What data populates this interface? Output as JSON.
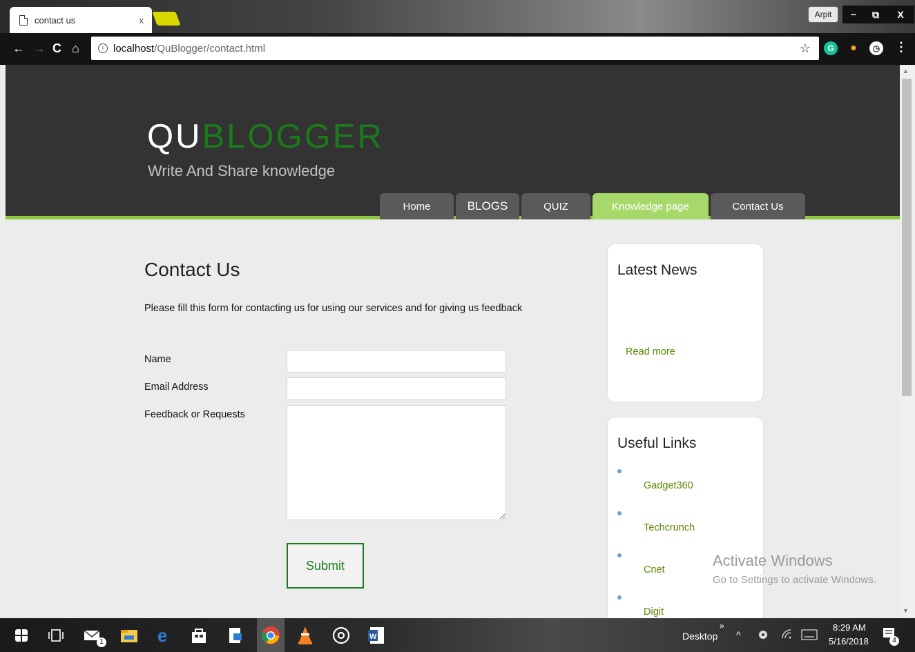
{
  "browser": {
    "tab_title": "contact us",
    "tab_close": "x",
    "profile_name": "Arpit",
    "win_controls": [
      "−",
      "⧉",
      "X"
    ],
    "nav": {
      "back": "←",
      "forward": "→",
      "reload": "C",
      "home": "⌂"
    },
    "url_host": "localhost",
    "url_path": "/QuBlogger/contact.html",
    "info_icon": "i",
    "star": "☆",
    "extensions": [
      {
        "label": "G",
        "color": "#15c39a",
        "icon": "grammarly-icon"
      },
      {
        "label": "●",
        "color": "#f5a623",
        "icon": "bulb-icon"
      },
      {
        "label": "◷",
        "color": "#333333",
        "icon": "gauge-icon"
      }
    ],
    "menu_dots": "⋮"
  },
  "site": {
    "logo_qu": "QU",
    "logo_rest": "BLOGGER",
    "tagline": "Write And Share knowledge",
    "menu": [
      {
        "label": "Home",
        "active": false
      },
      {
        "label": "BLOGS",
        "active": false
      },
      {
        "label": "QUIZ",
        "active": false
      },
      {
        "label": "Knowledge page",
        "active": true
      },
      {
        "label": "Contact Us",
        "active": false
      }
    ]
  },
  "contact": {
    "heading": "Contact Us",
    "intro": "Please fill this form for contacting us for using our services and for giving us feedback",
    "name_label": "Name",
    "email_label": "Email Address",
    "feedback_label": "Feedback or Requests",
    "name_value": "",
    "email_value": "",
    "feedback_value": "",
    "submit_label": "Submit"
  },
  "sidebar": {
    "news_title": "Latest News",
    "read_more": "Read more",
    "links_title": "Useful Links",
    "links": [
      "Gadget360",
      "Techcrunch",
      "Cnet",
      "Digit"
    ]
  },
  "watermark": {
    "title": "Activate Windows",
    "subtitle": "Go to Settings to activate Windows."
  },
  "taskbar": {
    "desktop_label": "Desktop",
    "chevron": "»",
    "time": "8:29 AM",
    "date": "5/16/2018",
    "mail_badge": "1",
    "notification_count": "4"
  },
  "colors": {
    "accent_green": "#1b7a1b",
    "menu_active": "#a6d96a",
    "link_green": "#5a8a00",
    "header_bg": "#333333"
  }
}
